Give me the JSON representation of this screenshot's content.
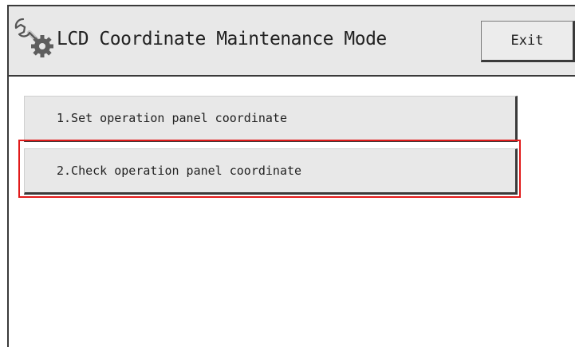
{
  "header": {
    "title": "LCD Coordinate Maintenance Mode",
    "icon": "wrench-gear-icon",
    "exit_label": "Exit"
  },
  "menu": {
    "items": [
      {
        "label": "1.Set operation panel coordinate"
      },
      {
        "label": "2.Check operation panel coordinate"
      }
    ]
  },
  "highlight": {
    "color": "#e11a1a",
    "target": "2.Check operation panel coordinate"
  }
}
